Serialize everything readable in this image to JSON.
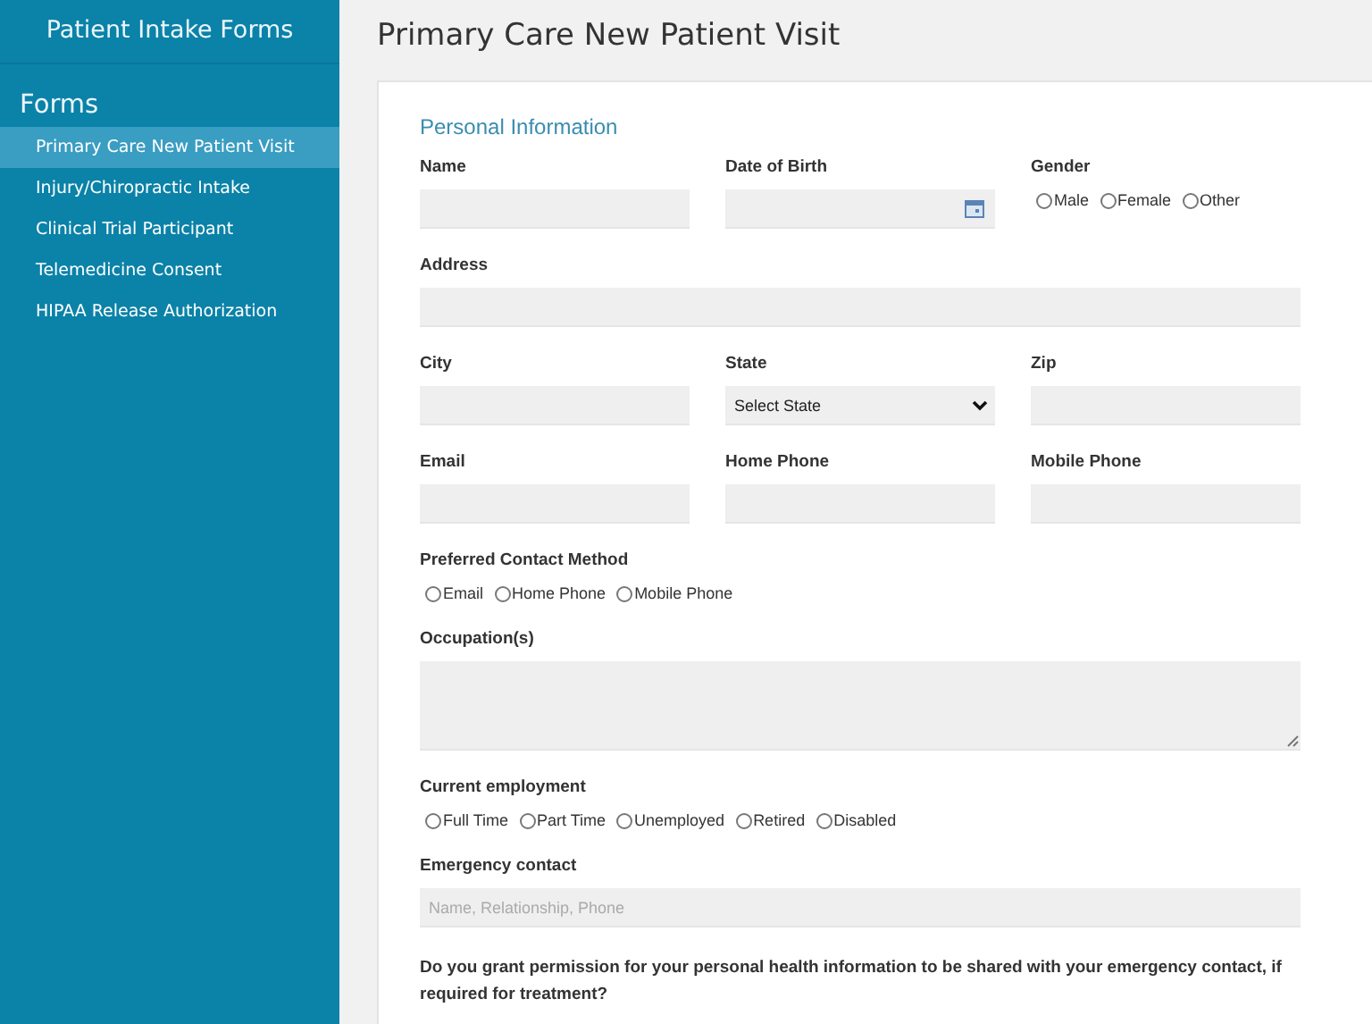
{
  "sidebar": {
    "title": "Patient Intake Forms",
    "section": "Forms",
    "items": [
      {
        "label": "Primary Care New Patient Visit",
        "selected": true
      },
      {
        "label": "Injury/Chiropractic Intake",
        "selected": false
      },
      {
        "label": "Clinical Trial Participant",
        "selected": false
      },
      {
        "label": "Telemedicine Consent",
        "selected": false
      },
      {
        "label": "HIPAA Release Authorization",
        "selected": false
      }
    ]
  },
  "page_title": "Primary Care New Patient Visit",
  "section_heading": "Personal Information",
  "rows": [
    [
      {
        "kind": "text",
        "label": "Name"
      },
      {
        "kind": "date",
        "label": "Date of Birth"
      },
      {
        "kind": "radio",
        "label": "Gender",
        "options": [
          {
            "label": "Male",
            "selected": false
          },
          {
            "label": "Female",
            "selected": false
          },
          {
            "label": "Other",
            "selected": false
          }
        ]
      }
    ],
    [
      {
        "kind": "text",
        "label": "Address"
      }
    ],
    [
      {
        "kind": "text",
        "label": "City"
      },
      {
        "kind": "select",
        "label": "State",
        "value": "Select State"
      },
      {
        "kind": "text",
        "label": "Zip"
      }
    ],
    [
      {
        "kind": "text",
        "label": "Email"
      },
      {
        "kind": "text",
        "label": "Home Phone"
      },
      {
        "kind": "text",
        "label": "Mobile Phone"
      }
    ],
    [
      {
        "kind": "radio",
        "label": "Preferred Contact Method",
        "options": [
          {
            "label": "Email",
            "selected": false
          },
          {
            "label": "Home Phone",
            "selected": false
          },
          {
            "label": "Mobile Phone",
            "selected": false
          }
        ]
      }
    ],
    [
      {
        "kind": "textarea",
        "label": "Occupation(s)"
      }
    ],
    [
      {
        "kind": "radio",
        "label": "Current employment",
        "options": [
          {
            "label": "Full Time",
            "selected": false
          },
          {
            "label": "Part Time",
            "selected": false
          },
          {
            "label": "Unemployed",
            "selected": false
          },
          {
            "label": "Retired",
            "selected": false
          },
          {
            "label": "Disabled",
            "selected": false
          }
        ]
      }
    ],
    [
      {
        "kind": "text",
        "label": "Emergency contact",
        "placeholder": "Name, Relationship, Phone"
      }
    ],
    [
      {
        "kind": "question",
        "label": "Do you grant permission for your personal health information to be shared with your emergency contact, if required for treatment?"
      }
    ]
  ]
}
